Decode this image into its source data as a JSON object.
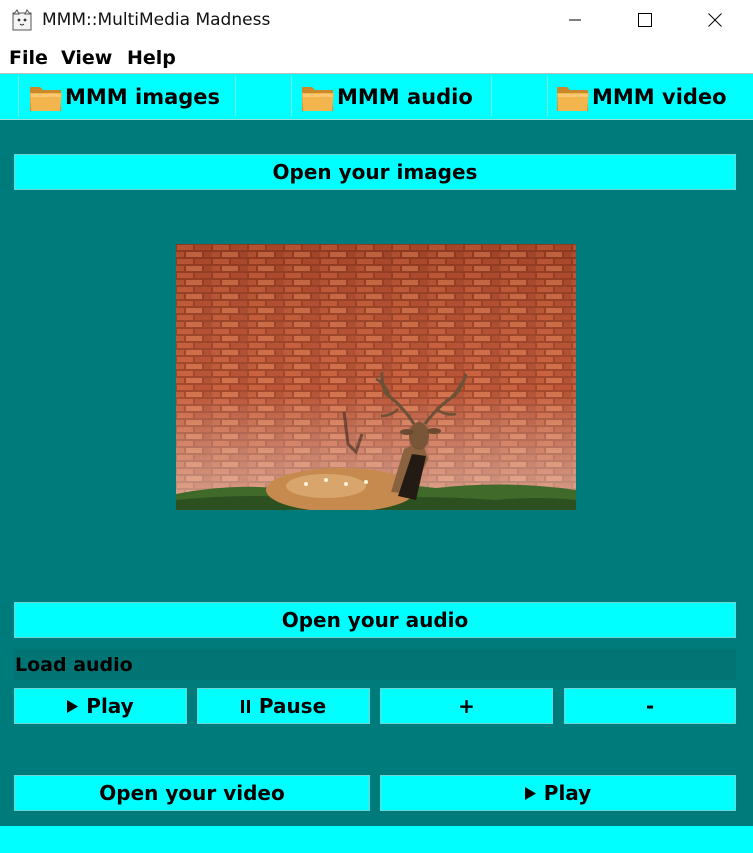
{
  "window": {
    "title": "MMM::MultiMedia Madness",
    "icons": {
      "app": "cat-icon",
      "minimize": "minimize-icon",
      "maximize": "maximize-icon",
      "close": "close-icon"
    }
  },
  "menu": {
    "items": [
      "File",
      "View",
      "Help"
    ]
  },
  "tabs": [
    {
      "label": "MMM images",
      "icon": "folder-icon"
    },
    {
      "label": "MMM audio",
      "icon": "folder-icon"
    },
    {
      "label": "MMM video",
      "icon": "folder-icon"
    }
  ],
  "images": {
    "open_label": "Open your images"
  },
  "audio": {
    "open_label": "Open your audio",
    "status_label": "Load audio",
    "controls": {
      "play": {
        "label": "Play",
        "icon": "play-icon"
      },
      "pause": {
        "label": "Pause",
        "icon": "pause-icon"
      },
      "plus": {
        "label": "+"
      },
      "minus": {
        "label": "-"
      }
    }
  },
  "video": {
    "open_label": "Open your video",
    "play": {
      "label": "Play",
      "icon": "play-icon"
    }
  },
  "colors": {
    "accent": "#00ffff",
    "panel": "#007b7b",
    "load_bar": "#037474"
  }
}
